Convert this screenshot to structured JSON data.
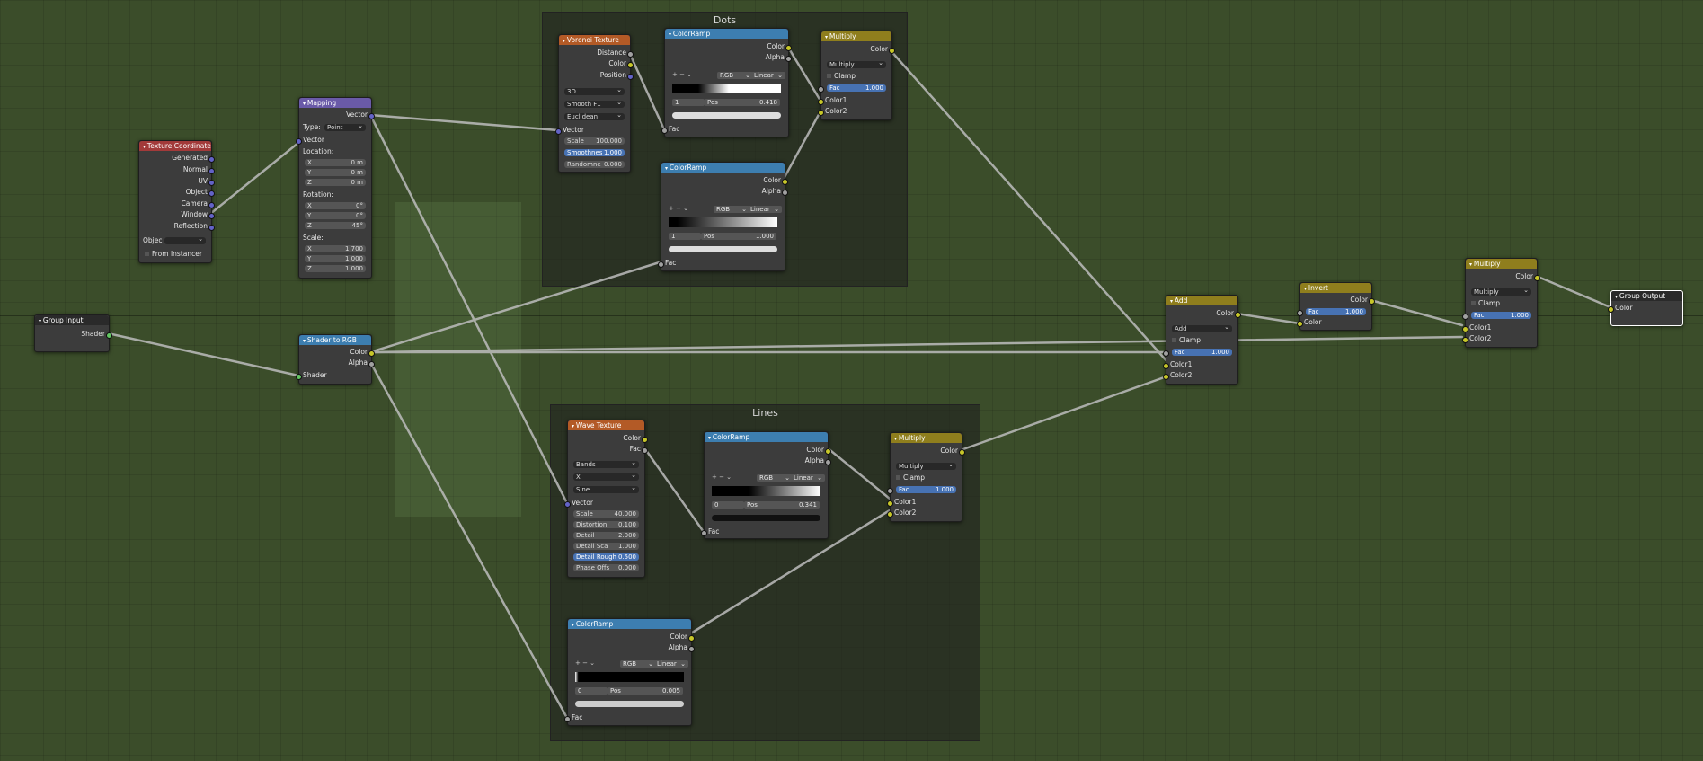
{
  "frames": {
    "dots": "Dots",
    "lines": "Lines"
  },
  "texcoord": {
    "title": "Texture Coordinate",
    "outputs": [
      "Generated",
      "Normal",
      "UV",
      "Object",
      "Camera",
      "Window",
      "Reflection"
    ],
    "object_label": "Objec",
    "from_instancer": "From Instancer"
  },
  "mapping": {
    "title": "Mapping",
    "out": "Vector",
    "type_label": "Type:",
    "type_value": "Point",
    "in_vector": "Vector",
    "location_label": "Location:",
    "location": [
      {
        "axis": "X",
        "v": "0 m"
      },
      {
        "axis": "Y",
        "v": "0 m"
      },
      {
        "axis": "Z",
        "v": "0 m"
      }
    ],
    "rotation_label": "Rotation:",
    "rotation": [
      {
        "axis": "X",
        "v": "0°"
      },
      {
        "axis": "Y",
        "v": "0°"
      },
      {
        "axis": "Z",
        "v": "45°"
      }
    ],
    "scale_label": "Scale:",
    "scale": [
      {
        "axis": "X",
        "v": "1.700"
      },
      {
        "axis": "Y",
        "v": "1.000"
      },
      {
        "axis": "Z",
        "v": "1.000"
      }
    ]
  },
  "group_input": {
    "title": "Group Input",
    "out": "Shader"
  },
  "shader_rgb": {
    "title": "Shader to RGB",
    "color": "Color",
    "alpha": "Alpha",
    "shader": "Shader"
  },
  "voronoi": {
    "title": "Voronoi Texture",
    "outputs": [
      "Distance",
      "Color",
      "Position"
    ],
    "dims": "3D",
    "feature": "Smooth F1",
    "metric": "Euclidean",
    "vector": "Vector",
    "fields": [
      {
        "label": "Scale",
        "v": "100.000"
      },
      {
        "label": "Smoothnes",
        "v": "1.000"
      },
      {
        "label": "Randomne",
        "v": "0.000"
      }
    ]
  },
  "ramp_dots_1": {
    "title": "ColorRamp",
    "color": "Color",
    "alpha": "Alpha",
    "mode": "RGB",
    "interp": "Linear",
    "index": "1",
    "pos_label": "Pos",
    "pos": "0.418",
    "fac": "Fac"
  },
  "ramp_dots_2": {
    "title": "ColorRamp",
    "color": "Color",
    "alpha": "Alpha",
    "mode": "RGB",
    "interp": "Linear",
    "index": "1",
    "pos_label": "Pos",
    "pos": "1.000",
    "fac": "Fac"
  },
  "mult_dots": {
    "title": "Multiply",
    "out": "Color",
    "blend": "Multiply",
    "clamp": "Clamp",
    "fac_label": "Fac",
    "fac": "1.000",
    "c1": "Color1",
    "c2": "Color2"
  },
  "wave": {
    "title": "Wave Texture",
    "outputs": [
      "Color",
      "Fac"
    ],
    "type": "Bands",
    "dir": "X",
    "profile": "Sine",
    "vector": "Vector",
    "fields": [
      {
        "label": "Scale",
        "v": "40.000"
      },
      {
        "label": "Distortion",
        "v": "0.100"
      },
      {
        "label": "Detail",
        "v": "2.000"
      },
      {
        "label": "Detail Sca",
        "v": "1.000"
      },
      {
        "label": "Detail Rough",
        "v": "0.500"
      },
      {
        "label": "Phase Offs",
        "v": "0.000"
      }
    ]
  },
  "ramp_lines_1": {
    "title": "ColorRamp",
    "color": "Color",
    "alpha": "Alpha",
    "mode": "RGB",
    "interp": "Linear",
    "index": "0",
    "pos_label": "Pos",
    "pos": "0.341",
    "fac": "Fac"
  },
  "ramp_lines_2": {
    "title": "ColorRamp",
    "color": "Color",
    "alpha": "Alpha",
    "mode": "RGB",
    "interp": "Linear",
    "index": "0",
    "pos_label": "Pos",
    "pos": "0.005",
    "fac": "Fac"
  },
  "mult_lines": {
    "title": "Multiply",
    "out": "Color",
    "blend": "Multiply",
    "clamp": "Clamp",
    "fac_label": "Fac",
    "fac": "1.000",
    "c1": "Color1",
    "c2": "Color2"
  },
  "add": {
    "title": "Add",
    "out": "Color",
    "blend": "Add",
    "clamp": "Clamp",
    "fac_label": "Fac",
    "fac": "1.000",
    "c1": "Color1",
    "c2": "Color2"
  },
  "invert": {
    "title": "Invert",
    "out": "Color",
    "fac_label": "Fac",
    "fac": "1.000",
    "in": "Color"
  },
  "mult_final": {
    "title": "Multiply",
    "out": "Color",
    "blend": "Multiply",
    "clamp": "Clamp",
    "fac_label": "Fac",
    "fac": "1.000",
    "c1": "Color1",
    "c2": "Color2"
  },
  "group_output": {
    "title": "Group Output",
    "in": "Color"
  },
  "ramp_tools": "+  −  ⌄",
  "colors": {
    "background": "#3b4d2a",
    "link": "#bdbdbd",
    "socket_color": "#c7c729",
    "socket_vector": "#6363c7",
    "socket_float": "#a1a1a1",
    "socket_shader": "#63c763",
    "accent": "#4772b3"
  }
}
